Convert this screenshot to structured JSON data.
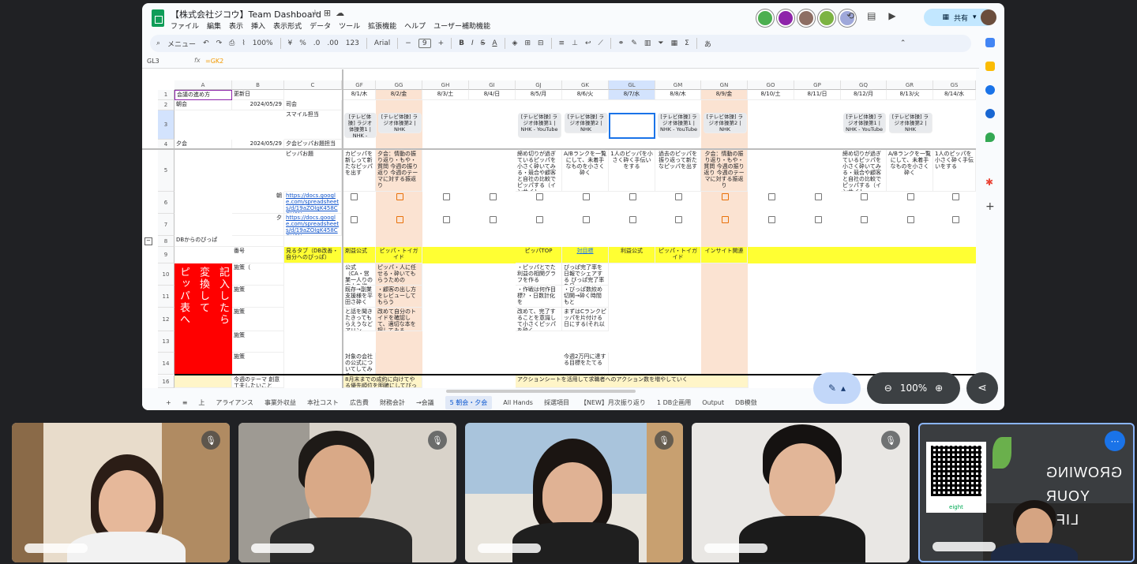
{
  "sheet": {
    "title": "【株式会社ジコウ】Team Dashboard",
    "menu": [
      "ファイル",
      "編集",
      "表示",
      "挿入",
      "表示形式",
      "データ",
      "ツール",
      "拡張機能",
      "ヘルプ",
      "ユーザー補助機能"
    ],
    "share_label": "共有",
    "toolbar": {
      "menu_search": "メニュー",
      "zoom": "100%",
      "currency": "¥",
      "percent": "%",
      "format_123": "123",
      "font": "Arial",
      "font_size": "9"
    },
    "name_box": "GL3",
    "formula": "=GK2",
    "columns": [
      "A",
      "B",
      "C",
      "GF",
      "GG",
      "GH",
      "GI",
      "GJ",
      "GK",
      "GL",
      "GM",
      "GN",
      "GO",
      "GP",
      "GQ",
      "GR",
      "GS"
    ],
    "rows": [
      "1",
      "2",
      "3",
      "4",
      "5",
      "6",
      "7",
      "8",
      "9",
      "10",
      "11",
      "12",
      "13",
      "14",
      "16"
    ],
    "dates": [
      "8/1/木",
      "8/2/金",
      "8/3/土",
      "8/4/日",
      "8/5/月",
      "8/6/火",
      "8/7/水",
      "8/8/木",
      "8/9/金",
      "8/10/土",
      "8/11/日",
      "8/12/月",
      "8/13/火",
      "8/14/水"
    ],
    "left_cells": {
      "a1": "会議の進め方",
      "b1": "更新日",
      "a2": "朝会",
      "b2": "2024/05/29",
      "c2": "司会",
      "c3": "スマイル担当",
      "a4": "夕会",
      "b4": "2024/05/29",
      "c4": "夕会ピッパお題担当",
      "c5": "ピッパお題",
      "b6": "朝",
      "b7": "夕",
      "link6": "https://docs.google.com/spreadsheets/d/19aZOIgK458CGH3Nnry",
      "link7": "https://docs.google.com/spreadsheets/d/19aZOIgK458CGH3Nnry",
      "a8": "DBからのぴっぱ",
      "b9": "番号",
      "c9": "見るタブ（DB改善・自分へのぴっぱ）",
      "b10": "施策（",
      "b11": "施策",
      "b12": "施策",
      "b13": "施策",
      "b14": "施策",
      "b16": "今週のテーマ 創意工夫したいこと",
      "red_box_columns": [
        "ピッパ表へ",
        "変換して",
        "記入したら"
      ]
    },
    "chips": {
      "gf3": "[テレビ体操] ラジオ体操第1 | NHK - YouTube",
      "gg3": "[テレビ体操] ラジオ体操第2 | NHK",
      "gj3": "[テレビ体操] ラジオ体操第1 | NHK - YouTube",
      "gk3": "[テレビ体操] ラジオ体操第2 | NHK",
      "gm3": "[テレビ体操] ラジオ体操第1 | NHK - YouTube",
      "gn3": "[テレビ体操] ラジオ体操第2 | NHK",
      "gq3": "[テレビ体操] ラジオ体操第1 | NHK - YouTube",
      "gr3": "[テレビ体操] ラジオ体操第2 | NHK"
    },
    "row5": {
      "gf": "カピッパを新しって新たなピッパを出す",
      "gg": "夕会：情動の振り返り・もや・質問 今週の振り返り 今週のテーマに対する振返り",
      "gj": "締め切りが過ぎているピッパを小さく砕いてみる・競合や顧客と自社の比較でピッパする（インサイト",
      "gk": "A/Bランクを一覧にして、未着手なものを小さく砕く",
      "gl": "1人のピッパを小さく砕く手伝いをする",
      "gm": "過去のピッパを振り返って新たなピッパを出す",
      "gn": "夕会：情動の振り返り・もや・質問 今週の振り返り 今週のテーマに対する振返り",
      "gq": "締め切りが過ぎているピッパを小さく砕いてみる・競合や顧客と自社の比較でピッパする（インサイト",
      "gr": "A/Bランクを一覧にして、未着手なものを小さく砕く",
      "gs": "1人のピッパを小さく砕く手伝いをする"
    },
    "row9": {
      "gf": "剤益公式",
      "gg": "ピッパ・トイガイド",
      "gj": "ピッパTOP",
      "gk": "対目標",
      "gl": "利益公式",
      "gm": "ピッパ・トイガイド",
      "gn": "インサイト関連"
    },
    "body_cells": {
      "gf10": "公式（CA・営業一人りの売上を増",
      "gg10": "ピッパ・人に任せる・砕いてもらうための",
      "gj10": "・ピッパとでた利益の相関グラフを作る",
      "gk10": "ぴっぱ完了率を日報でシェアする ぴっぱ完了率を日",
      "gf11": "既存→副業支援様を平田さ砕く",
      "gg11": "・顧客の出し方をレビューしてもらう",
      "gj11": "・作戦は何作目標? ・日数計化を",
      "gk11": "・ぴっぱ数絞め切開→砕く時間もと",
      "gf12": "と話を聞きたきってもらえうなどアリン",
      "gg12": "改めて自分のトイドを確認して、適切な本を探してみる",
      "gj12": "改めて、完了することを意識して小さくピッパを砕く",
      "gk12": "まずはCランクピッパを片付ける日にする(それ以",
      "gf14": "対象の会社の公式についてしてみる",
      "gk14": "今週2万円に達する目標をたてる",
      "gf16": "8月末までの成約に向けてやる優先順位を明確にしてぴっぱ",
      "gj16": "アクションシートを活用して求職者へのアクション数を増やしていく"
    },
    "tabs": [
      "上",
      "アライアンス",
      "事業外収益",
      "本社コスト",
      "広告費",
      "財務会計",
      "→会議",
      "5 朝会・夕会",
      "All Hands",
      "採選項目",
      "【NEW】月次振り返り",
      "1 DB企画用",
      "Output",
      "DB模倣"
    ],
    "active_tab": "5 朝会・夕会",
    "zoom_level": "100%"
  },
  "participants": [
    {
      "tile": 1,
      "muted": true
    },
    {
      "tile": 2,
      "muted": true
    },
    {
      "tile": 3,
      "muted": true
    },
    {
      "tile": 4,
      "muted": true
    },
    {
      "tile": 5,
      "muted": false,
      "qr_label": "eight",
      "background_text": [
        "GROWING",
        "YOUR",
        "LIFE"
      ]
    }
  ],
  "colors": {
    "accent": "#0b57d0",
    "sheets_green": "#0f9d58",
    "highlight_orange": "#fbe3d2",
    "highlight_yellow": "#ffff33",
    "red_box": "#ff0000",
    "meet_bg": "#202124"
  }
}
